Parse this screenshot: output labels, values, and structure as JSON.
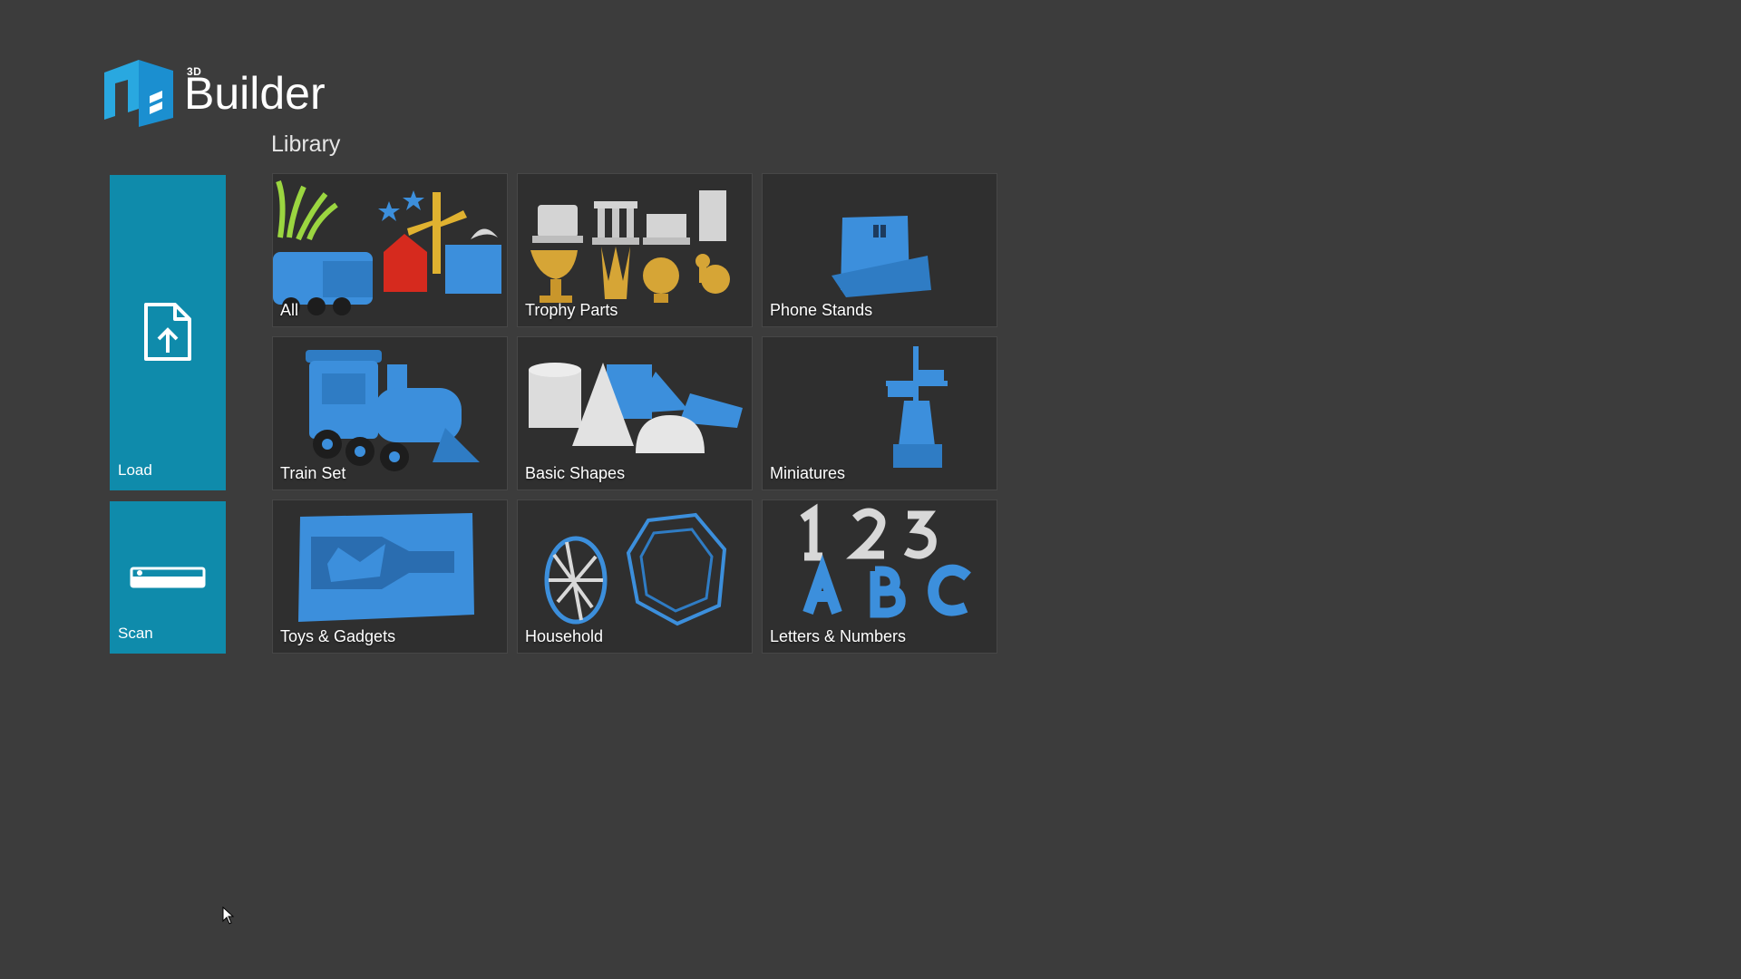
{
  "app": {
    "logo_superscript": "3D",
    "logo_name": "Builder"
  },
  "library": {
    "title": "Library"
  },
  "actions": [
    {
      "label": "Load",
      "icon": "file-upload-icon"
    },
    {
      "label": "Scan",
      "icon": "scanner-icon"
    }
  ],
  "tiles": [
    {
      "label": "All"
    },
    {
      "label": "Trophy Parts"
    },
    {
      "label": "Phone Stands"
    },
    {
      "label": "Train Set"
    },
    {
      "label": "Basic Shapes"
    },
    {
      "label": "Miniatures"
    },
    {
      "label": "Toys & Gadgets"
    },
    {
      "label": "Household"
    },
    {
      "label": "Letters & Numbers"
    }
  ],
  "colors": {
    "background": "#3c3c3c",
    "accent": "#0f8bab",
    "tile": "#2f2f2f",
    "model_blue": "#3c8fdc"
  }
}
